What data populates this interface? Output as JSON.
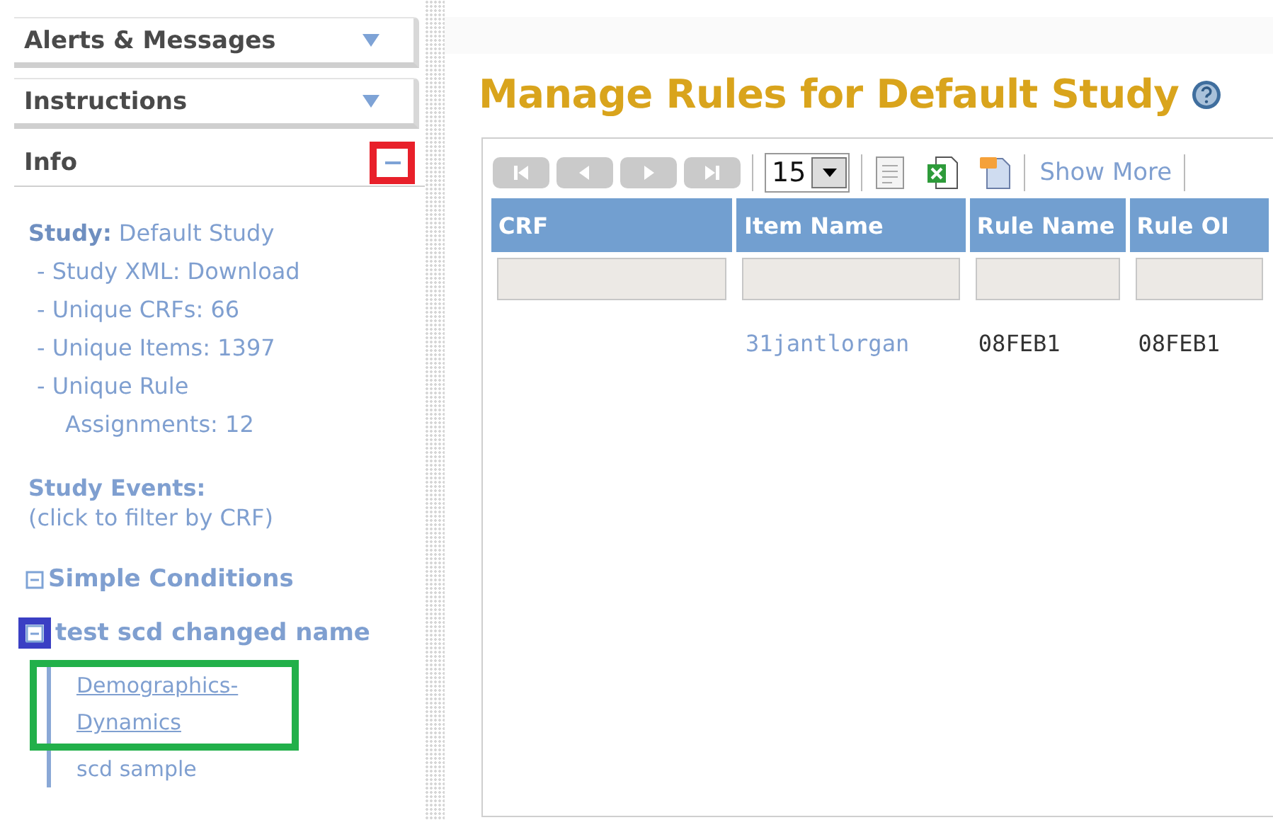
{
  "sidebar": {
    "panels": [
      {
        "title": "Alerts & Messages",
        "expanded": false
      },
      {
        "title": "Instructions",
        "expanded": false
      },
      {
        "title": "Info",
        "expanded": true,
        "color": "#e8202a"
      }
    ],
    "info_lines": [
      {
        "kind": "heading",
        "text": "**Study:**  Default Study"
      },
      {
        "kind": "sub",
        "text": "- Study XML: Download"
      },
      {
        "kind": "sub",
        "text": "- Unique CRFs:  66"
      },
      {
        "kind": "sub",
        "text": "- Unique Items:  1397"
      },
      {
        "kind": "sub",
        "text": "- Unique Rule Assignments:  12"
      }
    ],
    "events_heading": "Study Events:",
    "events_note": "(click to filter by CRF)",
    "tree": [
      {
        "label": "Simple Conditions",
        "expanded": true
      },
      {
        "label": "test scd changed name",
        "expanded": true,
        "color": "#3a3fc4",
        "children": [
          {
            "label": "Demographics-Dynamics",
            "kind": "link",
            "color": "#22b04a"
          },
          {
            "label": "scd sample",
            "kind": "plain"
          }
        ]
      }
    ]
  },
  "main": {
    "title": "Manage Rules for Default Study",
    "toolbar": {
      "nav_buttons": [
        {
          "kind": "first",
          "disabled": true
        },
        {
          "kind": "prev",
          "disabled": true
        },
        {
          "kind": "next",
          "disabled": true
        },
        {
          "kind": "last",
          "disabled": true
        }
      ],
      "page_size": "15",
      "show_more": "Show More"
    },
    "table": {
      "columns": [
        "CRF",
        "Item Name",
        "Rule Name",
        "Rule OI"
      ],
      "rows": [
        {
          "item_name": "31jantlorgan",
          "rule_name": "08FEB1",
          "column_4": "08FEB1"
        }
      ]
    }
  }
}
